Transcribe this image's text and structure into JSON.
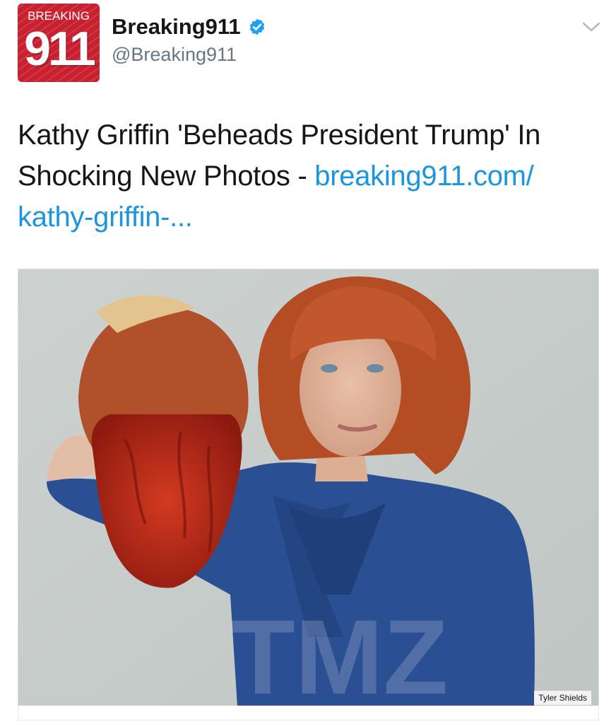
{
  "account": {
    "avatar_top_text": "BREAKING",
    "avatar_number": "911",
    "display_name": "Breaking911",
    "handle": "@Breaking911",
    "verified_icon": "verified-badge-icon",
    "menu_icon": "chevron-down-icon"
  },
  "tweet": {
    "text": "Kathy Griffin 'Beheads President Trump' In Shocking New Photos - ",
    "link_text": "breaking911.com/​kathy-griffin-..."
  },
  "media": {
    "watermark": "TMZ",
    "credit": "Tyler Shields"
  },
  "colors": {
    "avatar_red": "#c8202f",
    "link_blue": "#1b95e0",
    "verified_blue": "#1da1f2",
    "dress_blue": "#2a4f93",
    "hair_orange": "#c2562c"
  }
}
